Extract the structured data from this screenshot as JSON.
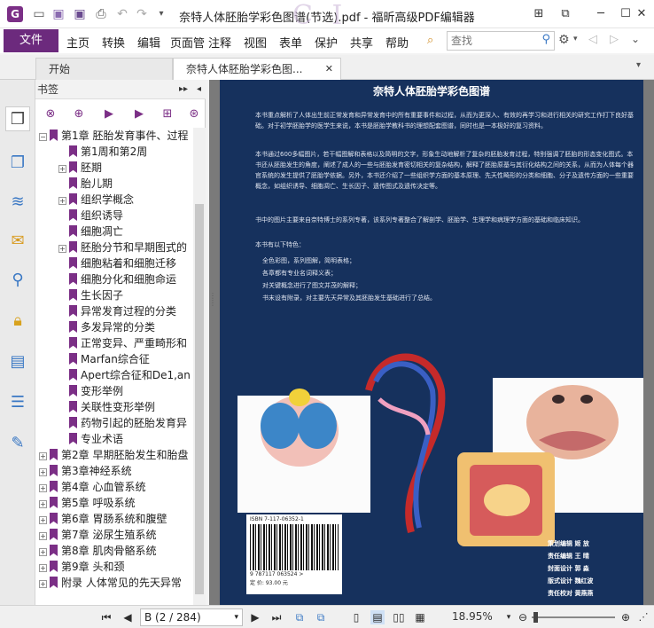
{
  "window": {
    "title": "奈特人体胚胎学彩色图谱(节选).pdf - 福昕高级PDF编辑器",
    "app_logo": "G",
    "watermark": "C I"
  },
  "quick_access": [
    "open-icon",
    "save-icon",
    "saveas-icon",
    "print-icon",
    "undo-icon",
    "redo-icon",
    "dropdown-icon"
  ],
  "menu": {
    "file_label": "文件",
    "items": [
      "主页",
      "转换",
      "编辑",
      "页面管",
      "注释",
      "视图",
      "表单",
      "保护",
      "共享",
      "帮助"
    ],
    "search_placeholder": "查找"
  },
  "tabs": [
    {
      "label": "开始"
    },
    {
      "label": "奈特人体胚胎学彩色图..."
    }
  ],
  "bookmark_panel": {
    "title": "书签",
    "items": [
      {
        "label": "第1章 胚胎发育事件、过程",
        "level": 0,
        "expander": "−"
      },
      {
        "label": "第1周和第2周",
        "level": 1,
        "expander": ""
      },
      {
        "label": "胚期",
        "level": 1,
        "expander": "+"
      },
      {
        "label": "胎儿期",
        "level": 1,
        "expander": ""
      },
      {
        "label": "组织学概念",
        "level": 1,
        "expander": "+"
      },
      {
        "label": "组织诱导",
        "level": 1,
        "expander": ""
      },
      {
        "label": "细胞凋亡",
        "level": 1,
        "expander": ""
      },
      {
        "label": "胚胎分节和早期图式的",
        "level": 1,
        "expander": "+"
      },
      {
        "label": "细胞粘着和细胞迁移",
        "level": 1,
        "expander": ""
      },
      {
        "label": "细胞分化和细胞命运",
        "level": 1,
        "expander": ""
      },
      {
        "label": "生长因子",
        "level": 1,
        "expander": ""
      },
      {
        "label": "异常发育过程的分类",
        "level": 1,
        "expander": ""
      },
      {
        "label": "多发异常的分类",
        "level": 1,
        "expander": ""
      },
      {
        "label": "正常变异、严重畸形和",
        "level": 1,
        "expander": ""
      },
      {
        "label": "Marfan综合征",
        "level": 1,
        "expander": ""
      },
      {
        "label": "Apert综合征和De1,an",
        "level": 1,
        "expander": ""
      },
      {
        "label": "变形举例",
        "level": 1,
        "expander": ""
      },
      {
        "label": "关联性变形举例",
        "level": 1,
        "expander": ""
      },
      {
        "label": "药物引起的胚胎发育异",
        "level": 1,
        "expander": ""
      },
      {
        "label": "专业术语",
        "level": 1,
        "expander": ""
      },
      {
        "label": "第2章 早期胚胎发生和胎盘",
        "level": 0,
        "expander": "+"
      },
      {
        "label": "第3章神经系统",
        "level": 0,
        "expander": "+"
      },
      {
        "label": "第4章 心血管系统",
        "level": 0,
        "expander": "+"
      },
      {
        "label": "第5章 呼吸系统",
        "level": 0,
        "expander": "+"
      },
      {
        "label": "第6章 胃肠系统和腹壁",
        "level": 0,
        "expander": "+"
      },
      {
        "label": "第7章 泌尿生殖系统",
        "level": 0,
        "expander": "+"
      },
      {
        "label": "第8章 肌肉骨骼系统",
        "level": 0,
        "expander": "+"
      },
      {
        "label": "第9章 头和颈",
        "level": 0,
        "expander": "+"
      },
      {
        "label": "附录 人体常见的先天异常",
        "level": 0,
        "expander": "+"
      }
    ]
  },
  "document_page": {
    "title": "奈特人体胚胎学彩色图谱",
    "paragraphs": [
      "本书重点解析了人体出生前正常发育和异常发育中的所有重要事件和过程，从而为更深入、有效的再学习和进行相关的研究工作打下良好基础。对于初学胚胎学的医学生来说，本书是胚胎学教科书的理想配套图谱，同时也是一本极好的复习资料。",
      "本书通过600多幅图片，若干幅图解和表格以及简明的文字，形象生动地解析了复杂的胚胎发育过程，特别强调了胚胎的形态变化图式。本书还从胚胎发生的角度，阐述了成人的一些与胚胎发育密切相关的复杂结构，解释了胚胎原基与其衍化结构之间的关系，从而为人体每个器官系统的发生提供了胚胎学依据。另外，本书还介绍了一些组织学方面的基本原理、先天性畸形的分类和细胞、分子及遗传方面的一些重要概念，如组织诱导、细胞凋亡、生长因子、遗传图式及遗传决定等。",
      "书中的图片主要来自奈特博士的系列专著，该系列专著整合了解剖学、胚胎学、生理学和病理学方面的基础和临床知识。",
      "本书有以下特色："
    ],
    "bullets": [
      "全色彩图，系列图解，简明表格；",
      "各章都有专业名词释义表；",
      "对关键概念进行了图文并茂的解释；",
      "书末设有附录，对主要先天异常及其胚胎发生基础进行了总结。"
    ],
    "isbn": "ISBN 7-117-06352-1",
    "barcode_number": "9 787117 063524 >",
    "price": "定 价: 93.00 元",
    "credits": [
      {
        "role": "策划编辑",
        "name": "姬 放"
      },
      {
        "role": "责任编辑",
        "name": "王 晴"
      },
      {
        "role": "封面设计",
        "name": "郭 淼"
      },
      {
        "role": "版式设计",
        "name": "魏红波"
      },
      {
        "role": "责任校对",
        "name": "黄燕燕"
      }
    ]
  },
  "status": {
    "page_indicator": "B (2 / 284)",
    "zoom": "18.95%"
  },
  "colors": {
    "accent": "#6c2a7d",
    "page_bg": "#16315d"
  }
}
